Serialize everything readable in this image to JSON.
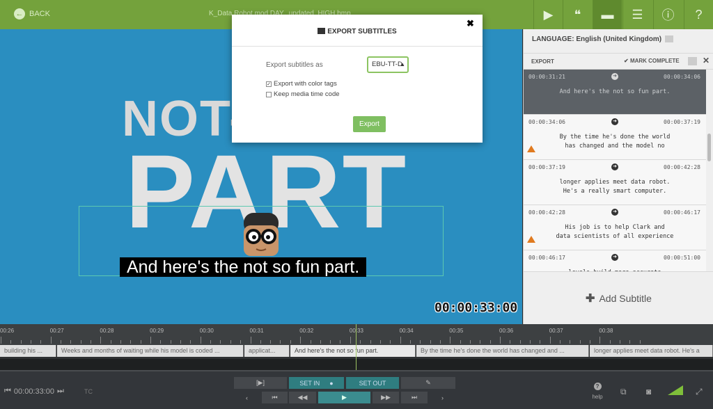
{
  "topbar": {
    "back_label": "BACK",
    "filename": "K_Data Robot mod DAY...updated_HIGH.bmp",
    "icons": [
      "play-icon",
      "quote-icon",
      "subtitles-icon",
      "list-icon",
      "info-icon",
      "help-icon"
    ],
    "accent": "#74a23c"
  },
  "video": {
    "big_text_1": "NOT-",
    "big_text_2": "PART",
    "subtitle": "And here's the not so fun part.",
    "timecode": "00:00:33:00",
    "background": "#2a8ec0"
  },
  "panel": {
    "language": "LANGUAGE: English (United Kingdom)",
    "export_label": "EXPORT",
    "mark_complete_label": "MARK COMPLETE",
    "cues": [
      {
        "start": "00:00:31:21",
        "end": "00:00:34:06",
        "text": "And here's the not so fun part.",
        "selected": true,
        "warning": false
      },
      {
        "start": "00:00:34:06",
        "end": "00:00:37:19",
        "text": "By the time he's done the world\nhas changed and the model no",
        "selected": false,
        "warning": true
      },
      {
        "start": "00:00:37:19",
        "end": "00:00:42:28",
        "text": "longer applies meet data robot.\nHe's a really smart computer.",
        "selected": false,
        "warning": false
      },
      {
        "start": "00:00:42:28",
        "end": "00:00:46:17",
        "text": "His job is to help Clark and\ndata scientists of all experience",
        "selected": false,
        "warning": true
      },
      {
        "start": "00:00:46:17",
        "end": "00:00:51:00",
        "text": "levels build more accurate",
        "selected": false,
        "warning": false
      }
    ],
    "add_subtitle_label": "Add Subtitle"
  },
  "timeline": {
    "ticks": [
      "00:26",
      "00:27",
      "00:28",
      "00:29",
      "00:30",
      "00:31",
      "00:32",
      "00:33",
      "00:34",
      "00:35",
      "00:36",
      "00:37",
      "00:38"
    ],
    "clips": [
      "building his ...",
      "Weeks and months of waiting while his model is coded ...",
      "applicat...",
      "And here's the not so fun part.",
      "By the time he's done the world has changed and ...",
      "longer applies meet data robot. He's a"
    ]
  },
  "controls": {
    "current_time": "00:00:33:00",
    "tc_label": "TC",
    "set_in_label": "SET IN",
    "set_out_label": "SET OUT",
    "help_label": "help"
  },
  "modal": {
    "title": "EXPORT SUBTITLES",
    "export_as_label": "Export subtitles as",
    "format_value": "EBU-TT-D",
    "option_color_tags": "Export with color tags",
    "option_color_tags_checked": true,
    "option_media_timecode": "Keep media time code",
    "option_media_timecode_checked": false,
    "export_button": "Export",
    "button_color": "#7fbf61"
  }
}
